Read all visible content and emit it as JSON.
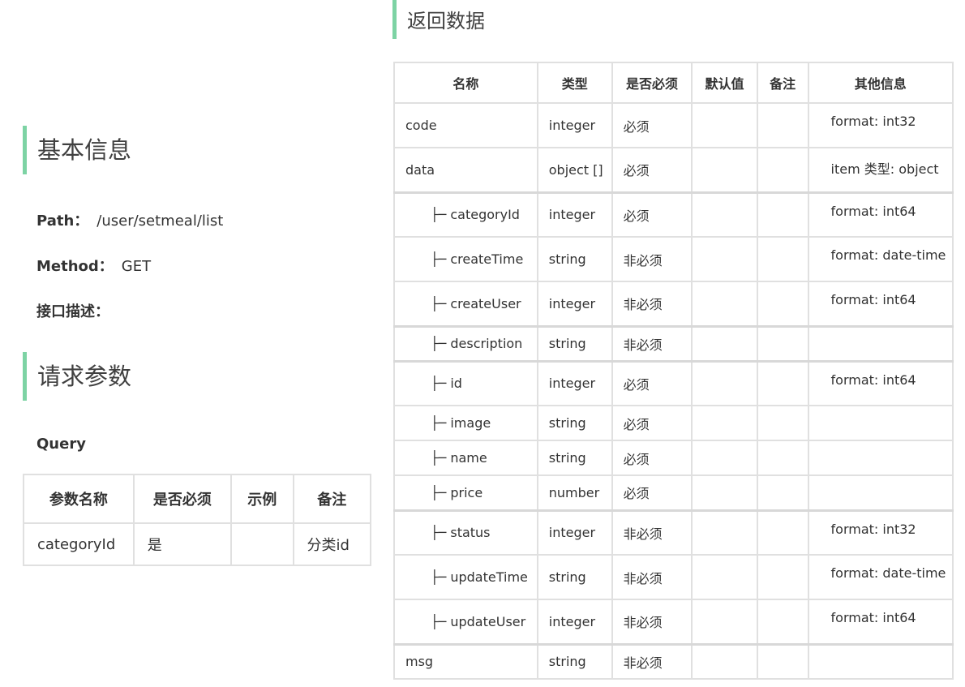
{
  "response": {
    "title": "返回数据"
  },
  "basic": {
    "title": "基本信息",
    "path_label": "Path：",
    "path_value": "/user/setmeal/list",
    "method_label": "Method：",
    "method_value": "GET",
    "desc_label": "接口描述："
  },
  "request": {
    "title": "请求参数",
    "query_label": "Query",
    "headers": [
      "参数名称",
      "是否必须",
      "示例",
      "备注"
    ],
    "rows": [
      [
        "categoryId",
        "是",
        "",
        "分类id"
      ]
    ]
  },
  "response_table": {
    "headers": [
      "名称",
      "类型",
      "是否必须",
      "默认值",
      "备注",
      "其他信息"
    ],
    "rows": [
      {
        "name": "code",
        "type": "integer",
        "required": "必须",
        "default": "",
        "note": "",
        "info": "format: int32",
        "child": false,
        "height": 55,
        "thick": false
      },
      {
        "name": "data",
        "type": "object []",
        "required": "必须",
        "default": "",
        "note": "",
        "info": "item 类型: object",
        "child": false,
        "height": 55,
        "thick": false
      },
      {
        "name": "├─ categoryId",
        "type": "integer",
        "required": "必须",
        "default": "",
        "note": "",
        "info": "format: int64",
        "child": true,
        "height": 55,
        "thick": true
      },
      {
        "name": "├─ createTime",
        "type": "string",
        "required": "非必须",
        "default": "",
        "note": "",
        "info": "format: date-time",
        "child": true,
        "height": 55,
        "thick": false
      },
      {
        "name": "├─ createUser",
        "type": "integer",
        "required": "非必须",
        "default": "",
        "note": "",
        "info": "format: int64",
        "child": true,
        "height": 55,
        "thick": false
      },
      {
        "name": "├─ description",
        "type": "string",
        "required": "非必须",
        "default": "",
        "note": "",
        "info": "",
        "child": true,
        "height": 43,
        "thick": true
      },
      {
        "name": "├─ id",
        "type": "integer",
        "required": "必须",
        "default": "",
        "note": "",
        "info": "format: int64",
        "child": true,
        "height": 55,
        "thick": true
      },
      {
        "name": "├─ image",
        "type": "string",
        "required": "必须",
        "default": "",
        "note": "",
        "info": "",
        "child": true,
        "height": 43,
        "thick": false
      },
      {
        "name": "├─ name",
        "type": "string",
        "required": "必须",
        "default": "",
        "note": "",
        "info": "",
        "child": true,
        "height": 43,
        "thick": false
      },
      {
        "name": "├─ price",
        "type": "number",
        "required": "必须",
        "default": "",
        "note": "",
        "info": "",
        "child": true,
        "height": 43,
        "thick": false
      },
      {
        "name": "├─ status",
        "type": "integer",
        "required": "非必须",
        "default": "",
        "note": "",
        "info": "format: int32",
        "child": true,
        "height": 55,
        "thick": true
      },
      {
        "name": "├─ updateTime",
        "type": "string",
        "required": "非必须",
        "default": "",
        "note": "",
        "info": "format: date-time",
        "child": true,
        "height": 55,
        "thick": false
      },
      {
        "name": "├─ updateUser",
        "type": "integer",
        "required": "非必须",
        "default": "",
        "note": "",
        "info": "format: int64",
        "child": true,
        "height": 55,
        "thick": false
      },
      {
        "name": "msg",
        "type": "string",
        "required": "非必须",
        "default": "",
        "note": "",
        "info": "",
        "child": false,
        "height": 43,
        "thick": true
      }
    ]
  },
  "colors": {
    "accent": "#7dd3a4",
    "border": "#e0e0e0",
    "text": "#333333"
  }
}
